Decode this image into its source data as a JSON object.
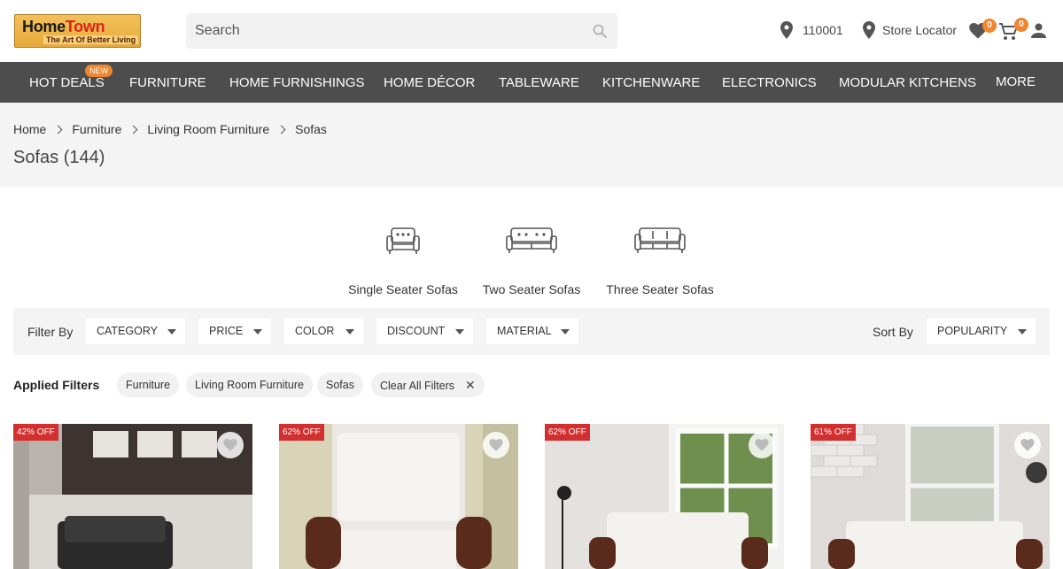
{
  "header": {
    "logo_main_a": "Home",
    "logo_main_b": "Town",
    "logo_tagline": "The Art Of Better Living",
    "search_placeholder": "Search",
    "pincode": "110001",
    "store_locator": "Store Locator",
    "wishlist_count": "0",
    "cart_count": "0"
  },
  "nav": {
    "items": [
      {
        "label": "HOT DEALS",
        "badge": "NEW"
      },
      {
        "label": "FURNITURE"
      },
      {
        "label": "HOME FURNISHINGS"
      },
      {
        "label": "HOME DÉCOR"
      },
      {
        "label": "TABLEWARE"
      },
      {
        "label": "KITCHENWARE"
      },
      {
        "label": "ELECTRONICS"
      },
      {
        "label": "MODULAR KITCHENS"
      },
      {
        "label": "MORE"
      }
    ]
  },
  "breadcrumb": [
    "Home",
    "Furniture",
    "Living Room Furniture",
    "Sofas"
  ],
  "page_title": "Sofas (144)",
  "subcategories": [
    {
      "label": "Single Seater Sofas",
      "icon": "single-seater-sofa-icon"
    },
    {
      "label": "Two Seater Sofas",
      "icon": "two-seater-sofa-icon"
    },
    {
      "label": "Three Seater Sofas",
      "icon": "three-seater-sofa-icon"
    }
  ],
  "filters": {
    "label": "Filter By",
    "items": [
      "CATEGORY",
      "PRICE",
      "COLOR",
      "DISCOUNT",
      "MATERIAL"
    ],
    "sort_label": "Sort By",
    "sort_value": "POPULARITY"
  },
  "applied_filters": {
    "label": "Applied Filters",
    "chips": [
      "Furniture",
      "Living Room Furniture",
      "Sofas"
    ],
    "clear_label": "Clear All Filters"
  },
  "products": [
    {
      "discount": "42% OFF"
    },
    {
      "discount": "62% OFF"
    },
    {
      "discount": "62% OFF"
    },
    {
      "discount": "61% OFF"
    }
  ],
  "colors": {
    "nav_bg": "#4d4d4d",
    "accent_orange": "#f0872e",
    "discount_red": "#d32f2f"
  }
}
